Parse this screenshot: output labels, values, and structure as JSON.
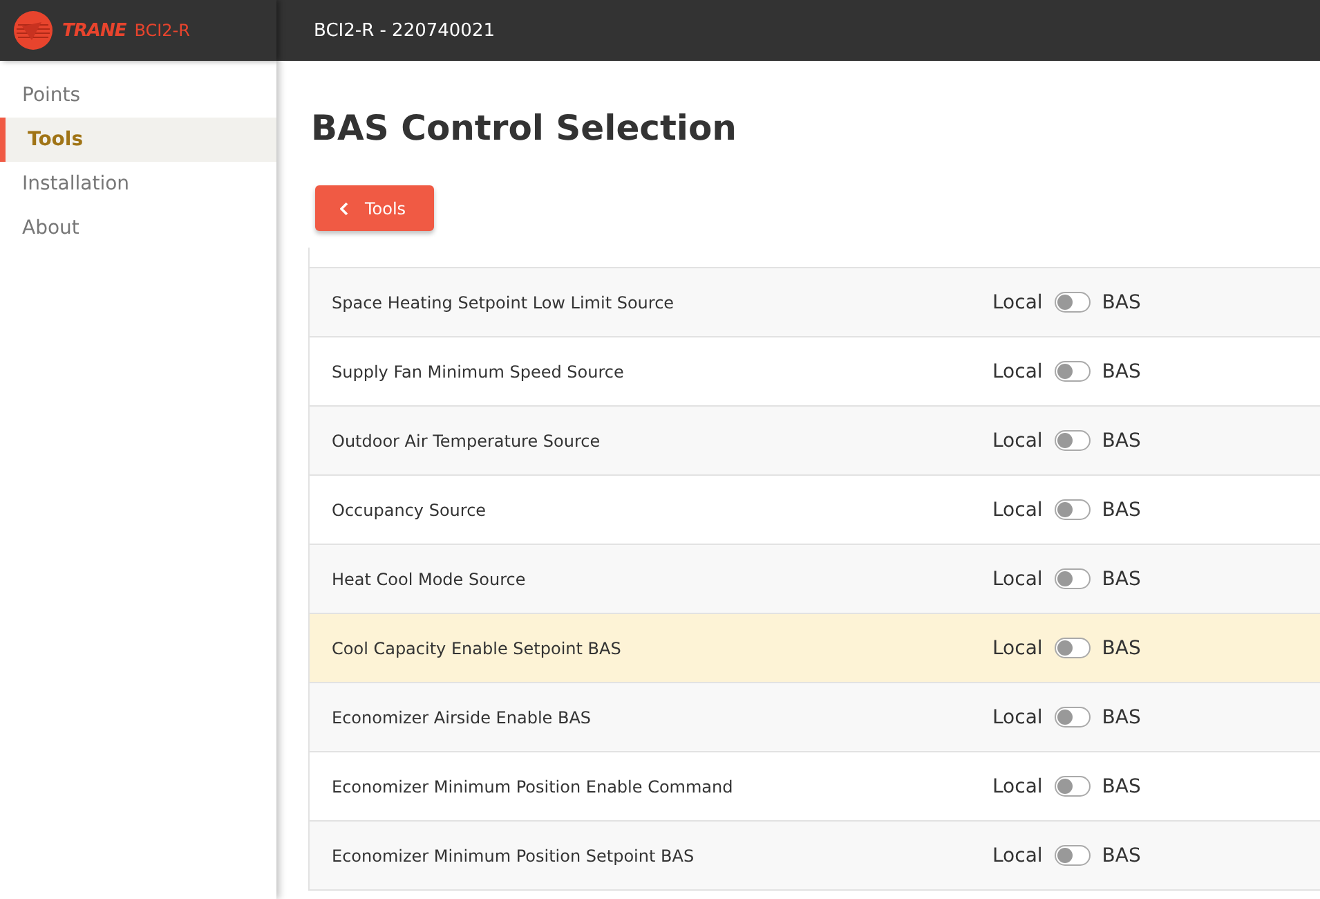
{
  "header": {
    "brand": "TRANE",
    "product": "BCI2-R",
    "device_title": "BCI2-R - 220740021"
  },
  "sidebar": {
    "items": [
      {
        "label": "Points",
        "selected": false
      },
      {
        "label": "Tools",
        "selected": true
      },
      {
        "label": "Installation",
        "selected": false
      },
      {
        "label": "About",
        "selected": false
      }
    ]
  },
  "page": {
    "title": "BAS Control Selection",
    "back_button": "Tools"
  },
  "rows": [
    {
      "name": "Space Heating Setpoint Low Limit Source",
      "left_label": "Local",
      "right_label": "BAS",
      "on": false,
      "selected": false
    },
    {
      "name": "Supply Fan Minimum Speed Source",
      "left_label": "Local",
      "right_label": "BAS",
      "on": false,
      "selected": false
    },
    {
      "name": "Outdoor Air Temperature Source",
      "left_label": "Local",
      "right_label": "BAS",
      "on": false,
      "selected": false
    },
    {
      "name": "Occupancy Source",
      "left_label": "Local",
      "right_label": "BAS",
      "on": false,
      "selected": false
    },
    {
      "name": "Heat Cool Mode Source",
      "left_label": "Local",
      "right_label": "BAS",
      "on": false,
      "selected": false
    },
    {
      "name": "Cool Capacity Enable Setpoint BAS",
      "left_label": "Local",
      "right_label": "BAS",
      "on": false,
      "selected": true
    },
    {
      "name": "Economizer Airside Enable BAS",
      "left_label": "Local",
      "right_label": "BAS",
      "on": false,
      "selected": false
    },
    {
      "name": "Economizer Minimum Position Enable Command",
      "left_label": "Local",
      "right_label": "BAS",
      "on": false,
      "selected": false
    },
    {
      "name": "Economizer Minimum Position Setpoint BAS",
      "left_label": "Local",
      "right_label": "BAS",
      "on": false,
      "selected": false
    }
  ]
}
